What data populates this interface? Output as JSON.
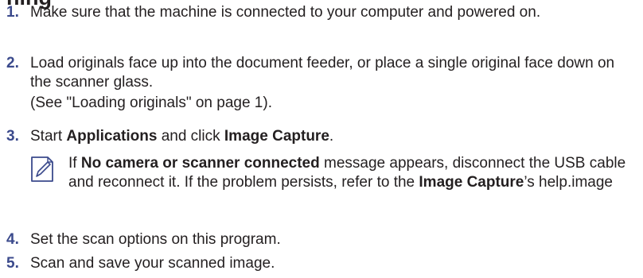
{
  "heading_fragment": "ning",
  "steps": [
    {
      "num": "1.",
      "text": "Make sure that the machine is connected to your computer and powered on."
    },
    {
      "num": "2.",
      "text": "Load originals face up into the document feeder, or place a single original face down on the scanner glass.",
      "subtext": "(See \"Loading originals\" on page 1)."
    },
    {
      "num": "3.",
      "pre": "Start ",
      "b1": "Applications",
      "mid": " and click ",
      "b2": "Image Capture",
      "post": "."
    },
    {
      "num": "4.",
      "text": "Set the scan options on this program."
    },
    {
      "num": "5.",
      "text": "Scan and save your scanned image."
    }
  ],
  "note": {
    "icon": "note-pencil-icon",
    "pre": "If ",
    "b1": "No camera or scanner connected",
    "mid": " message appears, disconnect the USB cable and reconnect it. If the problem persists, refer to the ",
    "b2": "Image Capture",
    "post": "’s help.image"
  }
}
